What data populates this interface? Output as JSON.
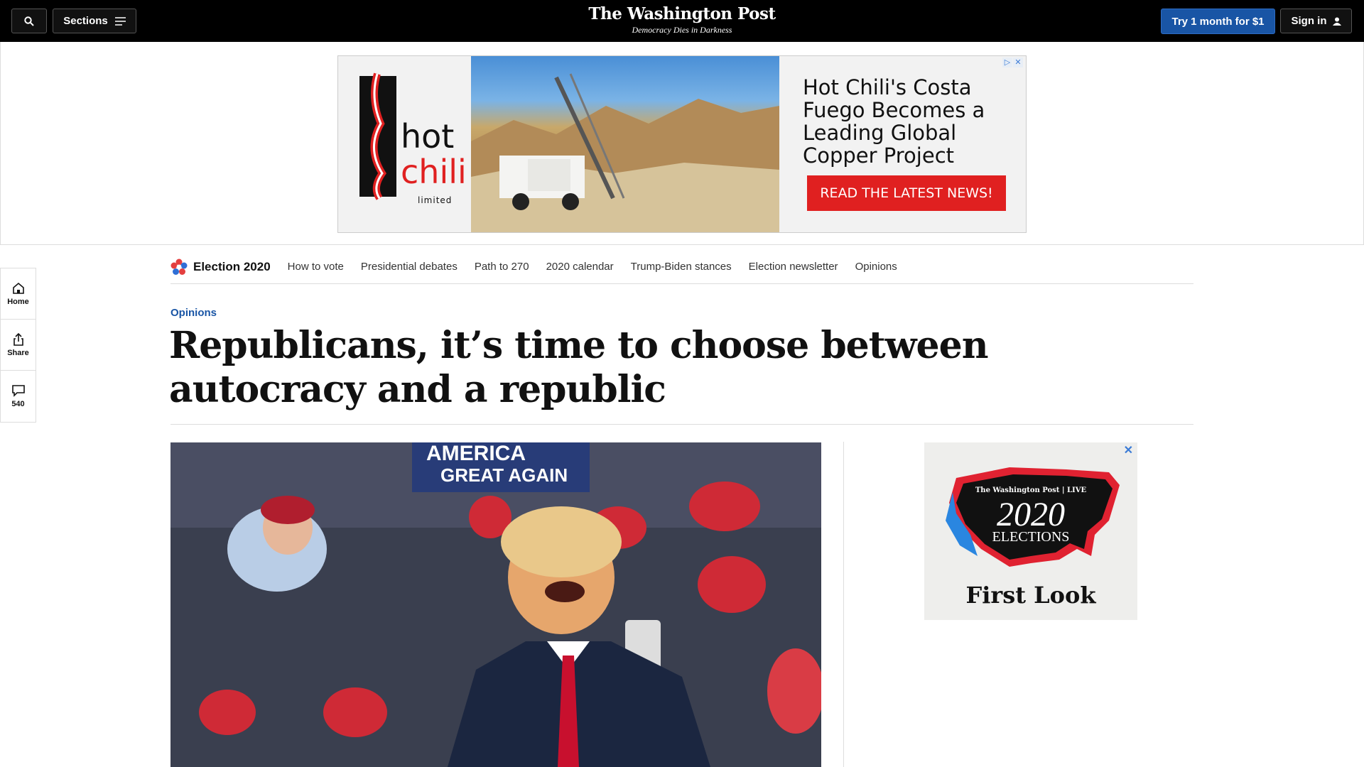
{
  "header": {
    "sections_label": "Sections",
    "brand_name": "The Washington Post",
    "brand_tagline": "Democracy Dies in Darkness",
    "subscribe_label": "Try 1 month for $1",
    "signin_label": "Sign in"
  },
  "top_ad": {
    "logo_word_1": "hot",
    "logo_word_2": "chili",
    "logo_word_3": "limited",
    "headline": "Hot Chili's Costa Fuego Becomes a Leading Global Copper Project",
    "cta": "READ THE LATEST NEWS!"
  },
  "election_nav": {
    "title": "Election 2020",
    "links": [
      "How to vote",
      "Presidential debates",
      "Path to 270",
      "2020 calendar",
      "Trump-Biden stances",
      "Election newsletter",
      "Opinions"
    ]
  },
  "rail": {
    "home": "Home",
    "share": "Share",
    "comments": "540"
  },
  "article": {
    "kicker": "Opinions",
    "headline": "Republicans, it’s time to choose between autocracy and a republic"
  },
  "side_ad": {
    "brand": "The Washington Post | LIVE",
    "year": "2020",
    "subtitle": "ELECTIONS",
    "title": "First Look"
  },
  "colors": {
    "accent": "#1955a5",
    "ad_cta": "#e02020"
  }
}
